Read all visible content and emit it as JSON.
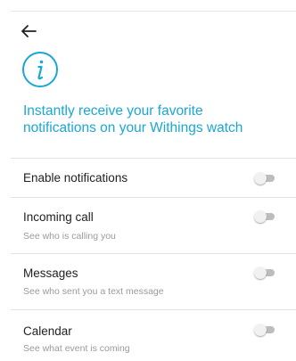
{
  "colors": {
    "accent": "#1aa7d6",
    "text": "#212121",
    "subtext": "#9a9a9a",
    "divider": "#e3e3e3"
  },
  "header": {
    "back_icon": "arrow-left-icon",
    "info_icon": "info-icon"
  },
  "intro": {
    "line1": "Instantly receive your favorite",
    "line2": "notifications on your Withings watch"
  },
  "settings": [
    {
      "title": "Enable notifications",
      "subtitle": "",
      "enabled": false
    },
    {
      "title": "Incoming call",
      "subtitle": "See who is calling you",
      "enabled": false
    },
    {
      "title": "Messages",
      "subtitle": "See who sent you a text message",
      "enabled": false
    },
    {
      "title": "Calendar",
      "subtitle": "See what event is coming",
      "enabled": false
    }
  ]
}
